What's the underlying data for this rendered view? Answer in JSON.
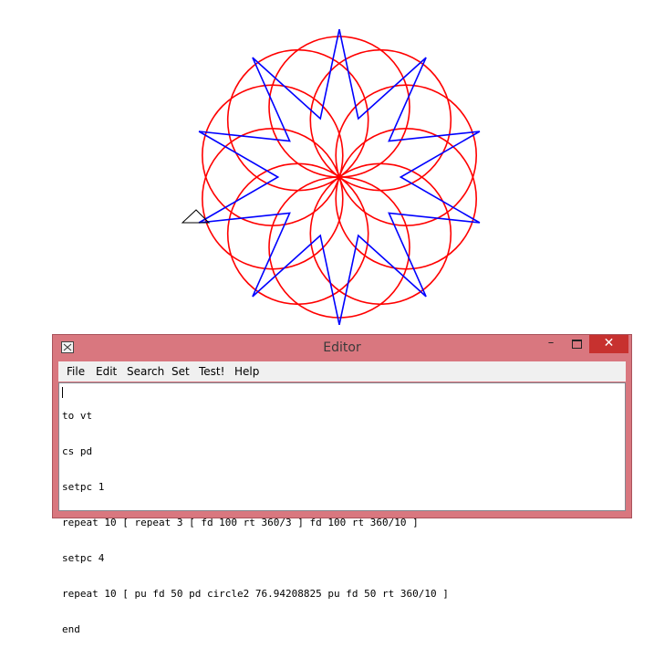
{
  "editor": {
    "title": "Editor",
    "menu": [
      "File",
      "Edit",
      "Search",
      "Set",
      "Test!",
      "Help"
    ],
    "code_lines": [
      "to vt",
      "cs pd",
      "setpc 1",
      "repeat 10 [ repeat 3 [ fd 100 rt 360/3 ] fd 100 rt 360/10 ]",
      "setpc 4",
      "repeat 10 [ pu fd 50 pd circle2 76.94208825 pu fd 50 rt 360/10 ]",
      "end"
    ],
    "buttons": {
      "minimize": "–",
      "close": "✕"
    }
  },
  "drawing": {
    "star_color": "#0000ff",
    "circle_color": "#ff0000",
    "star_points": 10,
    "circle_count": 10
  }
}
